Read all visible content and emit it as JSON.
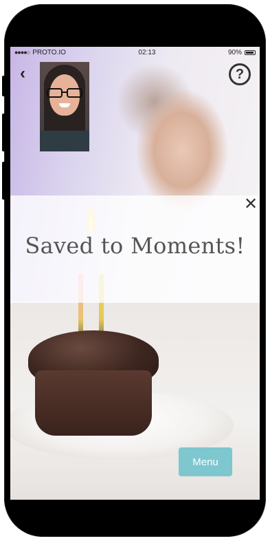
{
  "status_bar": {
    "carrier": "PROTO.IO",
    "time": "02:13",
    "battery": "90%"
  },
  "header": {
    "back_glyph": "‹",
    "help_glyph": "?"
  },
  "overlay": {
    "title": "Saved to Moments!",
    "close_glyph": "✕"
  },
  "menu": {
    "label": "Menu"
  },
  "colors": {
    "menu_button": "#7ec7cf"
  },
  "icons": [
    "back-icon",
    "help-icon",
    "close-icon",
    "battery-icon",
    "signal-icon"
  ]
}
